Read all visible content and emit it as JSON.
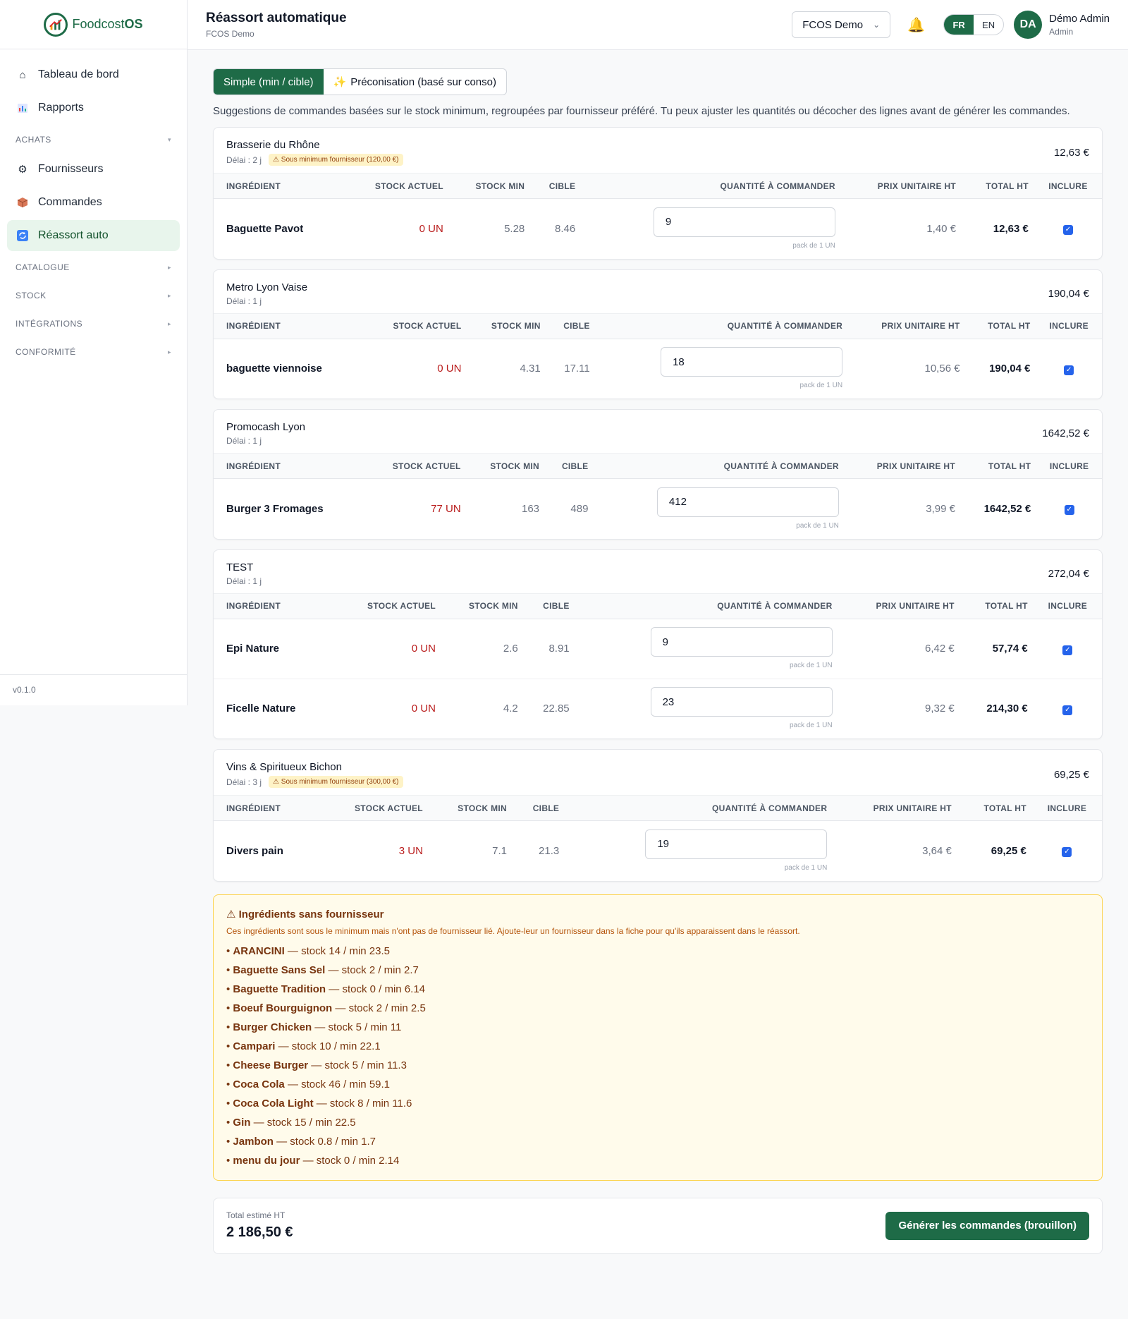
{
  "app": {
    "name_prefix": "Foodcost",
    "name_suffix": "OS"
  },
  "sidebar": {
    "items": [
      {
        "label": "Tableau de bord",
        "icon": "home-icon"
      },
      {
        "label": "Rapports",
        "icon": "bar-chart-icon"
      }
    ],
    "sections": {
      "achats": "ACHATS",
      "catalogue": "CATALOGUE",
      "stock": "STOCK",
      "integrations": "INTÉGRATIONS",
      "conformite": "CONFORMITÉ"
    },
    "achats_items": [
      {
        "label": "Fournisseurs",
        "icon": "gear-icon"
      },
      {
        "label": "Commandes",
        "icon": "box-icon"
      },
      {
        "label": "Réassort auto",
        "icon": "refresh-icon",
        "active": true
      }
    ],
    "version": "v0.1.0"
  },
  "header": {
    "title": "Réassort automatique",
    "subtitle": "FCOS Demo",
    "org_select": "FCOS Demo",
    "lang_fr": "FR",
    "lang_en": "EN",
    "avatar_initials": "DA",
    "user_name": "Démo Admin",
    "user_role": "Admin"
  },
  "tabs": {
    "simple": "Simple (min / cible)",
    "preco": "Préconisation (basé sur conso)",
    "preco_icon": "sparkle-icon"
  },
  "description": "Suggestions de commandes basées sur le stock minimum, regroupées par fournisseur préféré. Tu peux ajuster les quantités ou décocher des lignes avant de générer les commandes.",
  "columns": {
    "ingredient": "INGRÉDIENT",
    "stock_actuel": "STOCK ACTUEL",
    "stock_min": "STOCK MIN",
    "cible": "CIBLE",
    "quantite": "QUANTITÉ À COMMANDER",
    "prix": "PRIX UNITAIRE HT",
    "total": "TOTAL HT",
    "inclure": "INCLURE"
  },
  "suppliers": [
    {
      "name": "Brasserie du Rhône",
      "delay": "Délai : 2 j",
      "warning": "⚠ Sous minimum fournisseur (120,00 €)",
      "total": "12,63 €",
      "rows": [
        {
          "ingredient": "Baguette Pavot",
          "stock": "0 UN",
          "min": "5.28",
          "cible": "8.46",
          "qty": "9",
          "pack": "pack de 1 UN",
          "prix": "1,40 €",
          "total": "12,63 €",
          "included": true
        }
      ]
    },
    {
      "name": "Metro Lyon Vaise",
      "delay": "Délai : 1 j",
      "warning": "",
      "total": "190,04 €",
      "rows": [
        {
          "ingredient": "baguette viennoise",
          "stock": "0 UN",
          "min": "4.31",
          "cible": "17.11",
          "qty": "18",
          "pack": "pack de 1 UN",
          "prix": "10,56 €",
          "total": "190,04 €",
          "included": true
        }
      ]
    },
    {
      "name": "Promocash Lyon",
      "delay": "Délai : 1 j",
      "warning": "",
      "total": "1642,52 €",
      "rows": [
        {
          "ingredient": "Burger 3 Fromages",
          "stock": "77 UN",
          "min": "163",
          "cible": "489",
          "qty": "412",
          "pack": "pack de 1 UN",
          "prix": "3,99 €",
          "total": "1642,52 €",
          "included": true
        }
      ]
    },
    {
      "name": "TEST",
      "delay": "Délai : 1 j",
      "warning": "",
      "total": "272,04 €",
      "rows": [
        {
          "ingredient": "Epi Nature",
          "stock": "0 UN",
          "min": "2.6",
          "cible": "8.91",
          "qty": "9",
          "pack": "pack de 1 UN",
          "prix": "6,42 €",
          "total": "57,74 €",
          "included": true
        },
        {
          "ingredient": "Ficelle Nature",
          "stock": "0 UN",
          "min": "4.2",
          "cible": "22.85",
          "qty": "23",
          "pack": "pack de 1 UN",
          "prix": "9,32 €",
          "total": "214,30 €",
          "included": true
        }
      ]
    },
    {
      "name": "Vins & Spiritueux Bichon",
      "delay": "Délai : 3 j",
      "warning": "⚠ Sous minimum fournisseur (300,00 €)",
      "total": "69,25 €",
      "rows": [
        {
          "ingredient": "Divers pain",
          "stock": "3 UN",
          "min": "7.1",
          "cible": "21.3",
          "qty": "19",
          "pack": "pack de 1 UN",
          "prix": "3,64 €",
          "total": "69,25 €",
          "included": true
        }
      ]
    }
  ],
  "no_supplier": {
    "title": "⚠ Ingrédients sans fournisseur",
    "description": "Ces ingrédients sont sous le minimum mais n'ont pas de fournisseur lié. Ajoute-leur un fournisseur dans la fiche pour qu'ils apparaissent dans le réassort.",
    "items": [
      {
        "name": "ARANCINI",
        "detail": " — stock 14 / min 23.5"
      },
      {
        "name": "Baguette Sans Sel",
        "detail": " — stock 2 / min 2.7"
      },
      {
        "name": "Baguette Tradition",
        "detail": " — stock 0 / min 6.14"
      },
      {
        "name": "Boeuf Bourguignon",
        "detail": " — stock 2 / min 2.5"
      },
      {
        "name": "Burger Chicken",
        "detail": " — stock 5 / min 11"
      },
      {
        "name": "Campari",
        "detail": " — stock 10 / min 22.1"
      },
      {
        "name": "Cheese Burger",
        "detail": " — stock 5 / min 11.3"
      },
      {
        "name": "Coca Cola",
        "detail": " — stock 46 / min 59.1"
      },
      {
        "name": "Coca Cola Light",
        "detail": " — stock 8 / min 11.6"
      },
      {
        "name": "Gin",
        "detail": " — stock 15 / min 22.5"
      },
      {
        "name": "Jambon",
        "detail": " — stock 0.8 / min 1.7"
      },
      {
        "name": "menu du jour",
        "detail": " — stock 0 / min 2.14"
      }
    ]
  },
  "footer": {
    "total_label": "Total estimé HT",
    "total_value": "2 186,50 €",
    "generate_button": "Générer les commandes (brouillon)"
  },
  "colors": {
    "brand": "#1e6b47",
    "stock_alert": "#b91c1c",
    "warning_bg": "#fffbeb"
  }
}
